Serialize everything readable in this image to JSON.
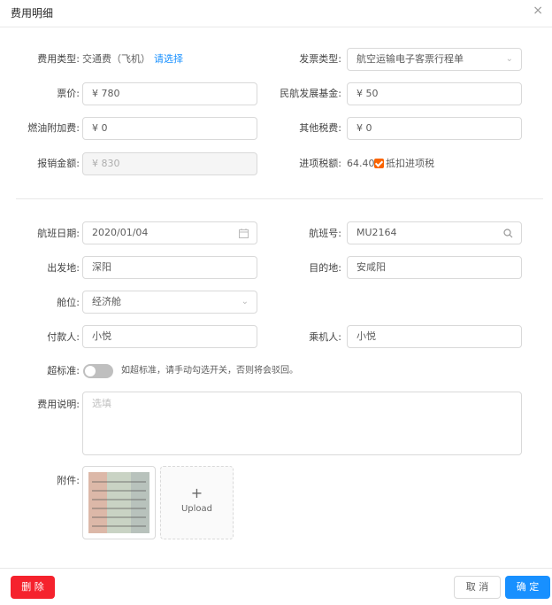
{
  "header": {
    "title": "费用明细",
    "close_icon": "×"
  },
  "section1": {
    "expense_type": {
      "label": "费用类型:",
      "value": "交通费（飞机）",
      "action": "请选择"
    },
    "invoice_type": {
      "label": "发票类型:",
      "value": "航空运输电子客票行程单"
    },
    "fare": {
      "label": "票价:",
      "value": "¥ 780"
    },
    "civil_fund": {
      "label": "民航发展基金:",
      "value": "¥ 50"
    },
    "fuel_surcharge": {
      "label": "燃油附加费:",
      "value": "¥ 0"
    },
    "other_tax": {
      "label": "其他税费:",
      "value": "¥ 0"
    },
    "reimburse_amount": {
      "label": "报销金额:",
      "value": "¥ 830"
    },
    "input_tax": {
      "label": "进项税额:",
      "value": "64.40",
      "checkbox_label": "抵扣进项税",
      "checked": true
    }
  },
  "section2": {
    "flight_date": {
      "label": "航班日期:",
      "value": "2020/01/04"
    },
    "flight_no": {
      "label": "航班号:",
      "value": "MU2164"
    },
    "departure": {
      "label": "出发地:",
      "value": "深阳"
    },
    "destination": {
      "label": "目的地:",
      "value": "安咸阳"
    },
    "cabin": {
      "label": "舱位:",
      "value": "经济舱"
    },
    "payer": {
      "label": "付款人:",
      "value": "小悦"
    },
    "passenger": {
      "label": "乘机人:",
      "value": "小悦"
    },
    "over_standard": {
      "label": "超标准:",
      "hint": "如超标准，请手动勾选开关，否则将会驳回。",
      "on": false
    },
    "description": {
      "label": "费用说明:",
      "placeholder": "选填"
    },
    "attachment": {
      "label": "附件:",
      "upload_plus": "+",
      "upload_text": "Upload"
    }
  },
  "footer": {
    "delete_label": "删 除",
    "cancel_label": "取 消",
    "confirm_label": "确 定"
  },
  "icons": {
    "select_arrow": "chevron-down-icon",
    "calendar": "calendar-icon",
    "search": "search-icon"
  },
  "colors": {
    "primary": "#1890ff",
    "danger": "#f5222d",
    "checkbox": "#fa6400"
  }
}
